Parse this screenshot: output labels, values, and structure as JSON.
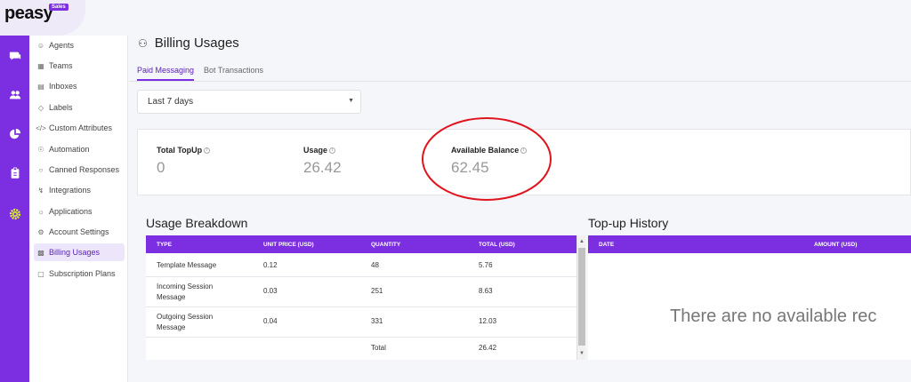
{
  "brand": {
    "name": "peasy",
    "badge": "Sales"
  },
  "rail": {
    "icons": [
      "chat-icon",
      "users-icon",
      "pie-chart-icon",
      "clipboard-icon",
      "gear-icon"
    ]
  },
  "nav": {
    "items": [
      {
        "label": "Agents",
        "icon": "agent-icon"
      },
      {
        "label": "Teams",
        "icon": "team-icon"
      },
      {
        "label": "Inboxes",
        "icon": "inbox-icon"
      },
      {
        "label": "Labels",
        "icon": "label-icon"
      },
      {
        "label": "Custom Attributes",
        "icon": "code-icon"
      },
      {
        "label": "Automation",
        "icon": "automation-icon"
      },
      {
        "label": "Canned Responses",
        "icon": "chat-icon"
      },
      {
        "label": "Integrations",
        "icon": "plug-icon"
      },
      {
        "label": "Applications",
        "icon": "applications-icon"
      },
      {
        "label": "Account Settings",
        "icon": "settings-icon"
      },
      {
        "label": "Billing Usages",
        "icon": "billing-icon"
      },
      {
        "label": "Subscription Plans",
        "icon": "subscription-icon"
      }
    ],
    "active_index": 10
  },
  "page": {
    "title": "Billing Usages"
  },
  "tabs": [
    {
      "label": "Paid Messaging",
      "active": true
    },
    {
      "label": "Bot Transactions",
      "active": false
    }
  ],
  "filter": {
    "selected": "Last 7 days"
  },
  "stats": {
    "total_topup": {
      "label": "Total TopUp",
      "value": "0"
    },
    "usage": {
      "label": "Usage",
      "value": "26.42"
    },
    "available_balance": {
      "label": "Available Balance",
      "value": "62.45"
    }
  },
  "usage_breakdown": {
    "title": "Usage Breakdown",
    "headers": [
      "TYPE",
      "UNIT PRICE (USD)",
      "QUANTITY",
      "TOTAL (USD)"
    ],
    "rows": [
      {
        "type": "Template Message",
        "unit_price": "0.12",
        "quantity": "48",
        "total": "5.76"
      },
      {
        "type": "Incoming Session Message",
        "unit_price": "0.03",
        "quantity": "251",
        "total": "8.63"
      },
      {
        "type": "Outgoing Session Message",
        "unit_price": "0.04",
        "quantity": "331",
        "total": "12.03"
      }
    ],
    "total_label": "Total",
    "total_value": "26.42"
  },
  "topup_history": {
    "title": "Top-up History",
    "headers": [
      "DATE",
      "AMOUNT (USD)"
    ],
    "empty_message": "There are no available rec"
  },
  "colors": {
    "accent": "#7b2fe0",
    "annotation": "#e0141e"
  }
}
